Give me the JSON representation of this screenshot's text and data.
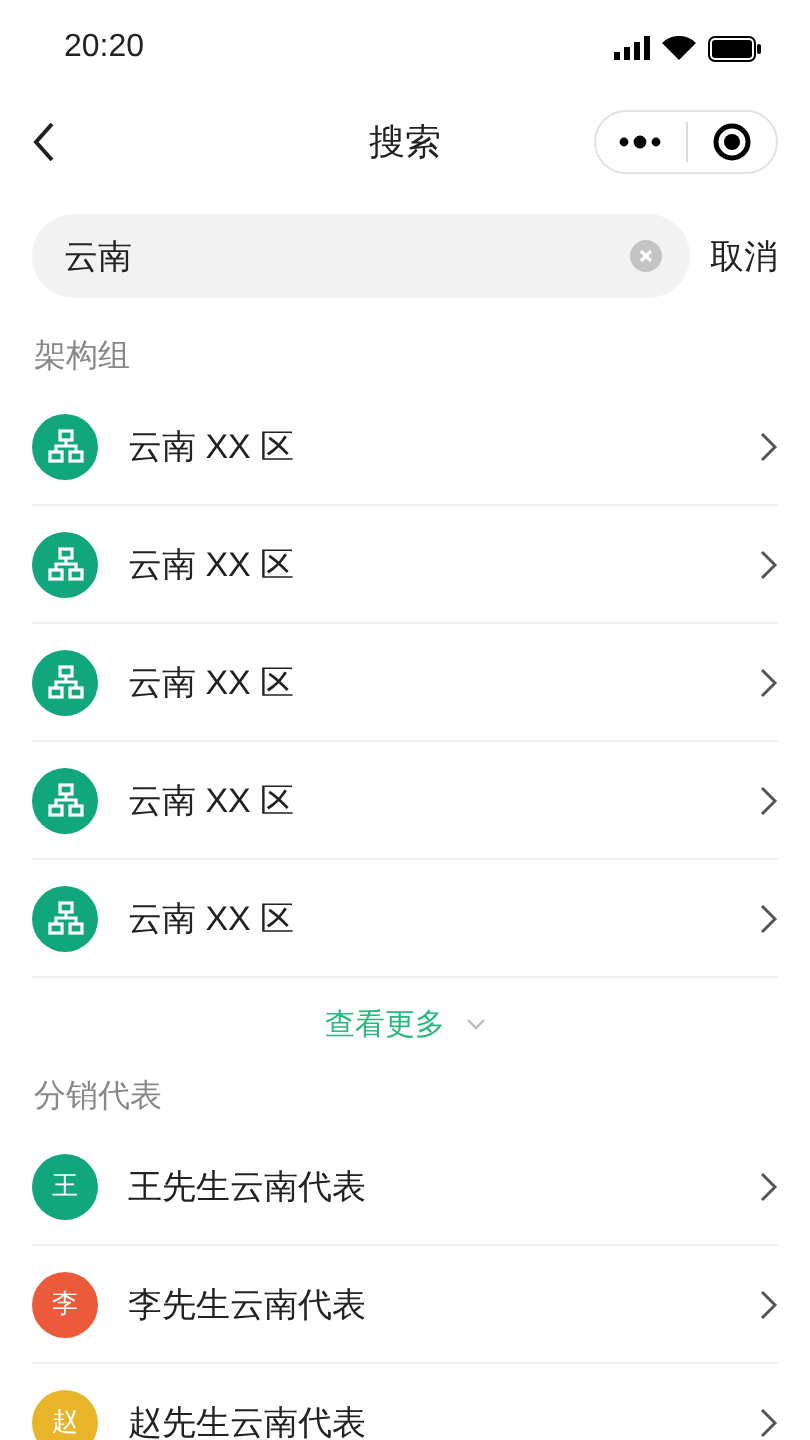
{
  "status_bar": {
    "time": "20:20"
  },
  "nav": {
    "title": "搜索"
  },
  "search": {
    "value": "云南",
    "cancel": "取消"
  },
  "sections": [
    {
      "title": "架构组",
      "items": [
        {
          "kind": "group",
          "label": "云南 XX 区"
        },
        {
          "kind": "group",
          "label": "云南 XX 区"
        },
        {
          "kind": "group",
          "label": "云南 XX 区"
        },
        {
          "kind": "group",
          "label": "云南 XX 区"
        },
        {
          "kind": "group",
          "label": "云南 XX 区"
        }
      ],
      "more": "查看更多"
    },
    {
      "title": "分销代表",
      "items": [
        {
          "kind": "person",
          "avatar": "王",
          "color": "#12a67c",
          "label": "王先生云南代表"
        },
        {
          "kind": "person",
          "avatar": "李",
          "color": "#ec5a3c",
          "label": "李先生云南代表"
        },
        {
          "kind": "person",
          "avatar": "赵",
          "color": "#e8b52a",
          "label": "赵先生云南代表"
        }
      ]
    }
  ]
}
